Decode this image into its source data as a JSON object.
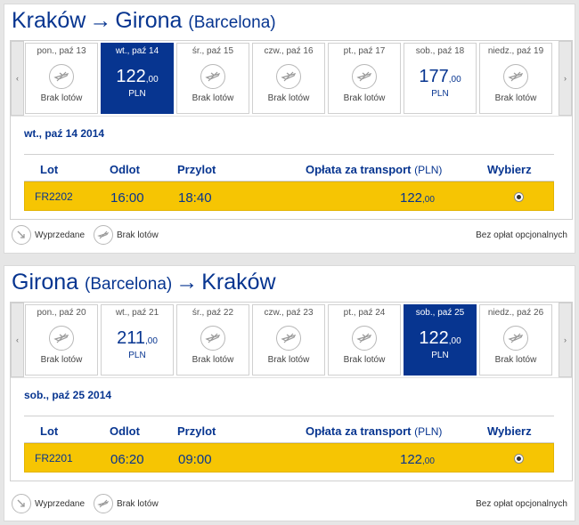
{
  "outbound": {
    "title": {
      "from": "Kraków",
      "arrow": "→",
      "to": "Girona",
      "to_note": "(Barcelona)"
    },
    "days": [
      {
        "date": "pon., paź 13",
        "status": "Brak lotów"
      },
      {
        "date": "wt., paź 14",
        "price_main": "122",
        "price_cents": ",00",
        "currency": "PLN",
        "selected": true
      },
      {
        "date": "śr., paź 15",
        "status": "Brak lotów"
      },
      {
        "date": "czw., paź 16",
        "status": "Brak lotów"
      },
      {
        "date": "pt., paź 17",
        "status": "Brak lotów"
      },
      {
        "date": "sob., paź 18",
        "price_main": "177",
        "price_cents": ",00",
        "currency": "PLN"
      },
      {
        "date": "niedz., paź 19",
        "status": "Brak lotów"
      }
    ],
    "selected_date_heading": "wt., paź 14 2014",
    "flight": {
      "number": "FR2202",
      "departure": "16:00",
      "arrival": "18:40",
      "fare_main": "122",
      "fare_cents": ",00"
    }
  },
  "return": {
    "title": {
      "from": "Girona",
      "from_note": "(Barcelona)",
      "arrow": "→",
      "to": "Kraków"
    },
    "days": [
      {
        "date": "pon., paź 20",
        "status": "Brak lotów"
      },
      {
        "date": "wt., paź 21",
        "price_main": "211",
        "price_cents": ",00",
        "currency": "PLN"
      },
      {
        "date": "śr., paź 22",
        "status": "Brak lotów"
      },
      {
        "date": "czw., paź 23",
        "status": "Brak lotów"
      },
      {
        "date": "pt., paź 24",
        "status": "Brak lotów"
      },
      {
        "date": "sob., paź 25",
        "price_main": "122",
        "price_cents": ",00",
        "currency": "PLN",
        "selected": true
      },
      {
        "date": "niedz., paź 26",
        "status": "Brak lotów"
      }
    ],
    "selected_date_heading": "sob., paź 25 2014",
    "flight": {
      "number": "FR2201",
      "departure": "06:20",
      "arrival": "09:00",
      "fare_main": "122",
      "fare_cents": ",00"
    }
  },
  "table_headers": {
    "flight": "Lot",
    "departure": "Odlot",
    "arrival": "Przylot",
    "fare": "Opłata za transport",
    "fare_unit": "(PLN)",
    "select": "Wybierz"
  },
  "nav": {
    "prev": "‹",
    "next": "›"
  },
  "legend": {
    "sold_out": "Wyprzedane",
    "no_flights": "Brak lotów",
    "no_fees": "Bez opłat opcjonalnych"
  },
  "icons": {
    "plane": "plane-icon",
    "sold_out": "plane-landing-icon",
    "no_flights": "plane-crossed-icon"
  },
  "colors": {
    "primary": "#073590",
    "highlight": "#f6c503",
    "selected_day_bg": "#073590"
  }
}
